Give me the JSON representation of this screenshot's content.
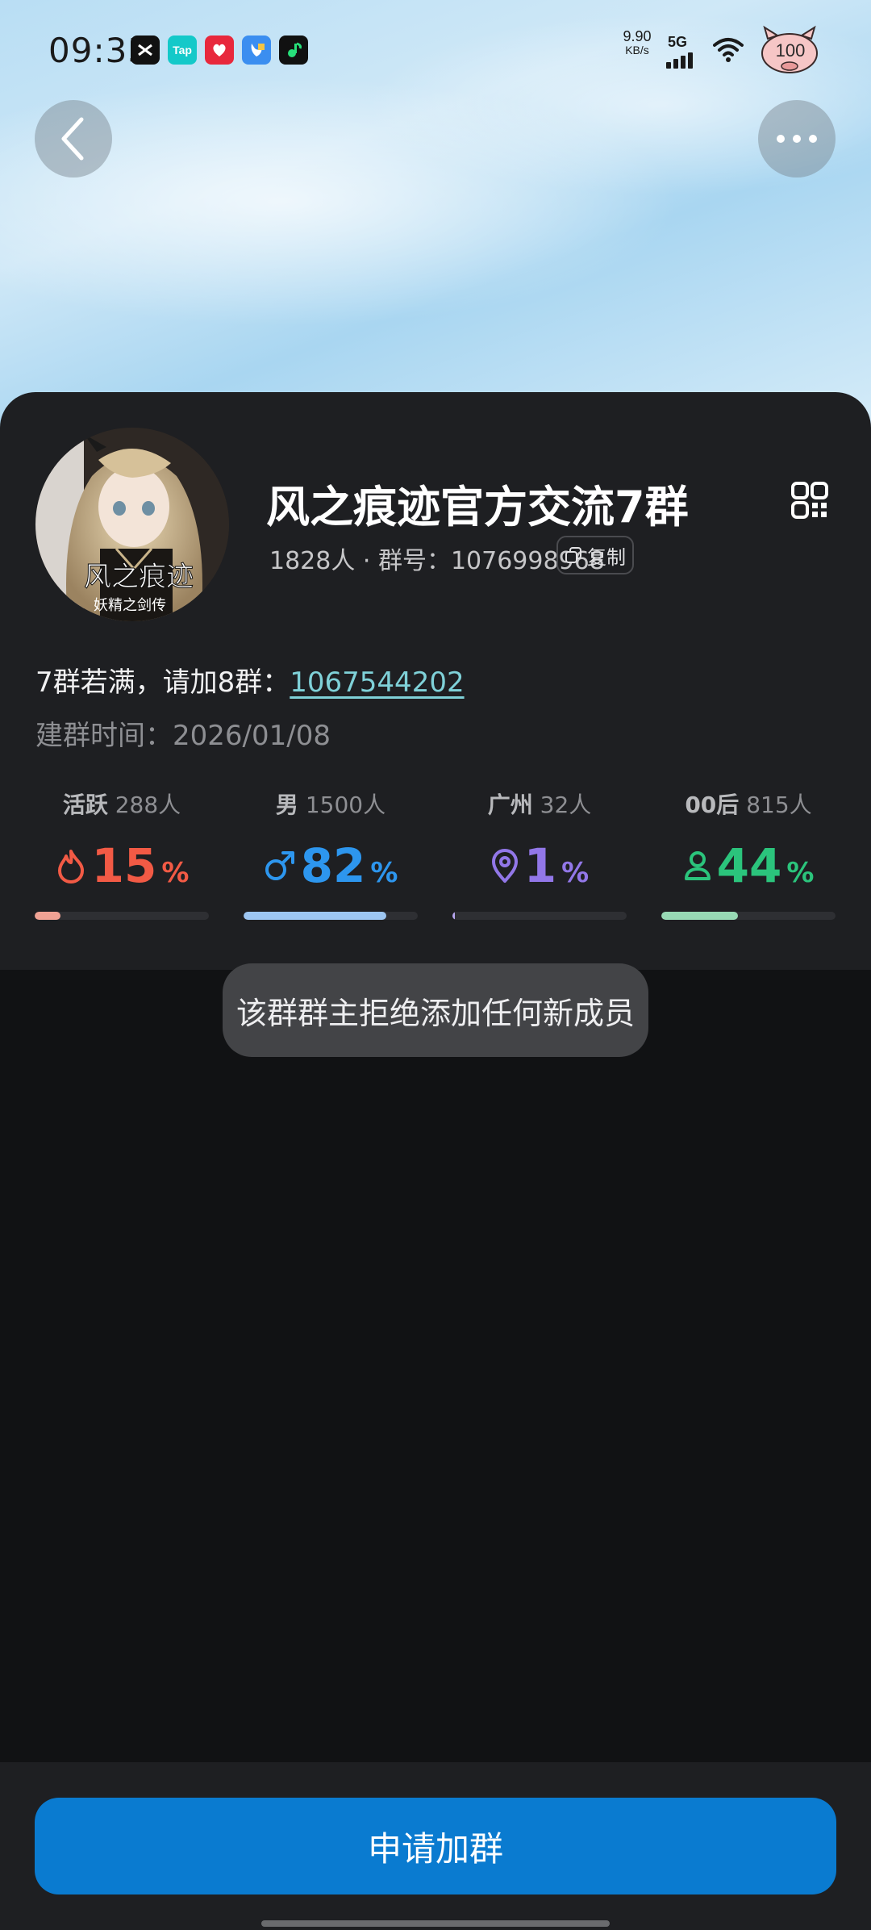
{
  "status_bar": {
    "time": "09:33",
    "net_speed_value": "9.90",
    "net_speed_unit": "KB/s",
    "network_type": "5G",
    "battery_level": "100",
    "apps": [
      {
        "name": "capcut-icon",
        "label": "",
        "color": "#111111"
      },
      {
        "name": "taptap-icon",
        "label": "Tap",
        "color": "#14c9c9"
      },
      {
        "name": "red-app-icon",
        "label": "",
        "color": "#e8283c"
      },
      {
        "name": "blue-app-icon",
        "label": "",
        "color": "#3b8ef0"
      },
      {
        "name": "music-app-icon",
        "label": "",
        "color": "#111111"
      }
    ]
  },
  "group": {
    "name": "风之痕迹官方交流7群",
    "meta": "1828人 · 群号：1076998968",
    "copy_label": "复制",
    "announce_prefix": "7群若满，请加8群：",
    "announce_link": "1067544202",
    "created": "建群时间：2026/01/08",
    "avatar_text": "风之痕迹",
    "avatar_subtext": "妖精之剑传"
  },
  "stats": [
    {
      "key": "活跃",
      "count": "288人",
      "value": "15",
      "unit": "%",
      "fraction": 0.15,
      "color": "#f25a45",
      "bar_color": "#f0a294",
      "icon": "flame-icon"
    },
    {
      "key": "男",
      "count": "1500人",
      "value": "82",
      "unit": "%",
      "fraction": 0.82,
      "color": "#2d96ee",
      "bar_color": "#9dc6f2",
      "icon": "male-icon"
    },
    {
      "key": "广州",
      "count": "32人",
      "value": "1",
      "unit": "%",
      "fraction": 0.01,
      "color": "#9277e8",
      "bar_color": "#b7a6f0",
      "icon": "location-pin-icon"
    },
    {
      "key": "00后",
      "count": "815人",
      "value": "44",
      "unit": "%",
      "fraction": 0.44,
      "color": "#2bc47c",
      "bar_color": "#98dab5",
      "icon": "person-icon"
    }
  ],
  "toast": "该群群主拒绝添加任何新成员",
  "join_button": "申请加群"
}
